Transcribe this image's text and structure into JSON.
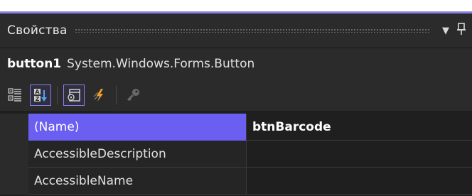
{
  "panel": {
    "title": "Свойства",
    "accent_color": "#8a7fe8",
    "selected_color": "#6b5ff2",
    "dropdown_icon": "triangle-down-icon",
    "pin_icon": "pin-icon"
  },
  "object": {
    "name": "button1",
    "type": "System.Windows.Forms.Button"
  },
  "toolbar": {
    "buttons": [
      {
        "icon": "categorized-icon",
        "active": false
      },
      {
        "icon": "alphabetical-icon",
        "active": true
      },
      {
        "icon": "properties-icon",
        "active": true
      },
      {
        "icon": "events-icon",
        "active": false
      },
      {
        "icon": "property-pages-icon",
        "active": false
      }
    ]
  },
  "properties": [
    {
      "name": "(Name)",
      "value": "btnBarcode",
      "selected": true,
      "bold": true
    },
    {
      "name": "AccessibleDescription",
      "value": "",
      "selected": false,
      "bold": false
    },
    {
      "name": "AccessibleName",
      "value": "",
      "selected": false,
      "bold": false
    }
  ]
}
